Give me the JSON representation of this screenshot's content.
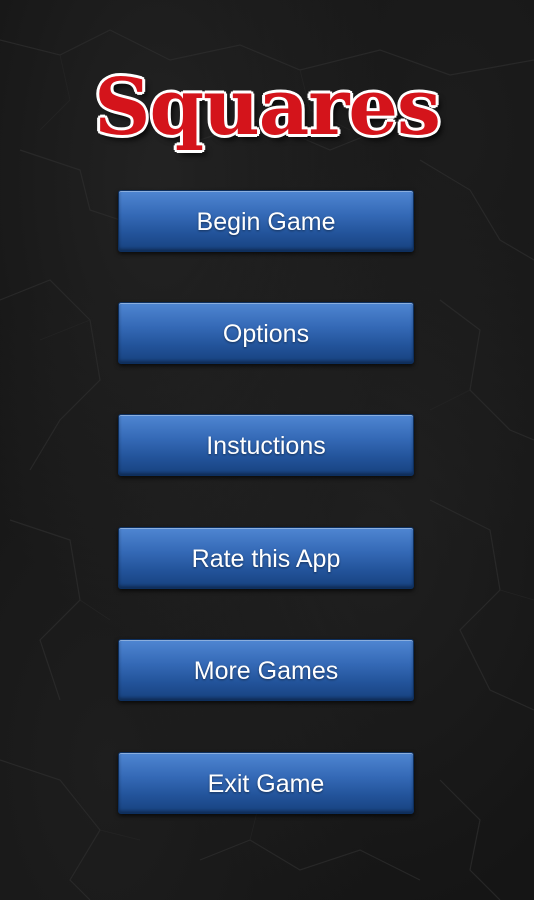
{
  "app": {
    "logo_text": "Squares"
  },
  "menu": {
    "begin_game_label": "Begin Game",
    "options_label": "Options",
    "instructions_label": "Instuctions",
    "rate_label": "Rate this App",
    "more_games_label": "More Games",
    "exit_label": "Exit Game"
  },
  "colors": {
    "background": "#151515",
    "logo_red": "#d4141b",
    "logo_outline": "#ffffff",
    "button_blue": "#2f63ad",
    "button_text": "#ffffff"
  }
}
